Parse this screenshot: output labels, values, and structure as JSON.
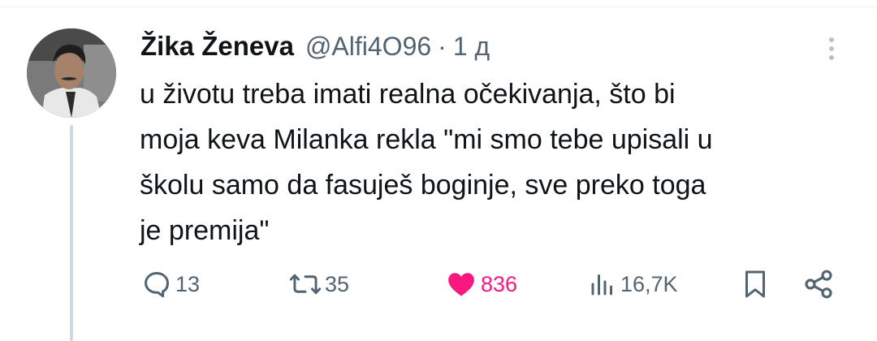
{
  "author": {
    "display_name": "Žika Ženeva",
    "handle": "@Alfi4O96",
    "separator": "·",
    "time": "1 д"
  },
  "tweet": {
    "text": "u životu treba imati realna očekivanja, što bi\nmoja keva Milanka rekla \"mi smo tebe upisali u\nškolu samo da fasuješ boginje, sve preko toga\nje premija\""
  },
  "actions": {
    "replies": "13",
    "retweets": "35",
    "likes": "836",
    "views": "16,7K"
  },
  "icons": {
    "reply": "reply-icon",
    "retweet": "retweet-icon",
    "like": "heart-icon",
    "views": "views-icon",
    "bookmark": "bookmark-icon",
    "share": "share-icon",
    "more": "more-vertical-icon"
  },
  "colors": {
    "text": "#0f1419",
    "secondary": "#536471",
    "like_active": "#f91880",
    "thread_line": "#cfd9de"
  }
}
